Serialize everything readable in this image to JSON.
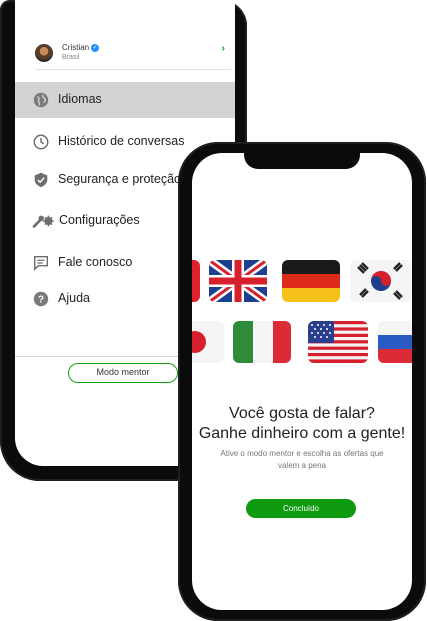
{
  "menu_screen": {
    "profile": {
      "name": "Cristian",
      "verified_icon": "verified-badge-icon",
      "subtitle": "Brasil",
      "chevron": "›"
    },
    "items": [
      {
        "label": "Idiomas",
        "icon": "globe-icon",
        "active": true
      },
      {
        "label": "Histórico de conversas",
        "icon": "clock-icon",
        "active": false
      },
      {
        "label": "Segurança e proteção",
        "icon": "shield-icon",
        "active": false
      },
      {
        "label": "Configurações",
        "icon": "tools-gear-icon",
        "active": false
      },
      {
        "label": "Fale conosco",
        "icon": "chat-message-icon",
        "active": false
      },
      {
        "label": "Ajuda",
        "icon": "help-icon",
        "active": false
      }
    ],
    "mentor_button": "Modo mentor"
  },
  "promo_screen": {
    "flags_row1": [
      "flag-partial-left-icon",
      "flag-uk-icon",
      "flag-germany-icon",
      "flag-south-korea-icon"
    ],
    "flags_row2": [
      "flag-japan-icon",
      "flag-italy-icon",
      "flag-usa-icon",
      "flag-russia-icon"
    ],
    "headline_line1": "Você gosta de falar?",
    "headline_line2": "Ganhe dinheiro com a gente!",
    "description": "Ative o modo mentor e escolha as ofertas que valem a pena",
    "done_button": "Concluído"
  },
  "colors": {
    "accent_green": "#0e9a0e",
    "active_row": "#d3d3d3"
  }
}
